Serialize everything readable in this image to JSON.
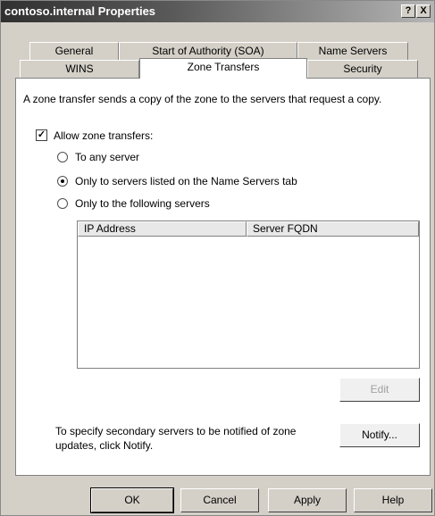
{
  "window": {
    "title": "contoso.internal Properties",
    "help_label": "?",
    "close_label": "X"
  },
  "tabs": {
    "general": "General",
    "soa": "Start of Authority (SOA)",
    "name_servers": "Name Servers",
    "wins": "WINS",
    "zone_transfers": "Zone Transfers",
    "security": "Security"
  },
  "panel": {
    "description": "A zone transfer sends a copy of the zone to the servers that request a copy.",
    "allow_label": "Allow zone transfers:",
    "allow_checked": true,
    "options": [
      {
        "label": "To any server",
        "selected": false
      },
      {
        "label": "Only to servers listed on the Name Servers tab",
        "selected": true
      },
      {
        "label": "Only to the following servers",
        "selected": false
      }
    ],
    "list_columns": [
      "IP Address",
      "Server FQDN"
    ],
    "edit_label": "Edit",
    "notify_text_line1": "To specify secondary servers to be notified of zone",
    "notify_text_line2": "updates, click Notify.",
    "notify_label": "Notify..."
  },
  "footer": {
    "ok": "OK",
    "cancel": "Cancel",
    "apply": "Apply",
    "help": "Help"
  }
}
